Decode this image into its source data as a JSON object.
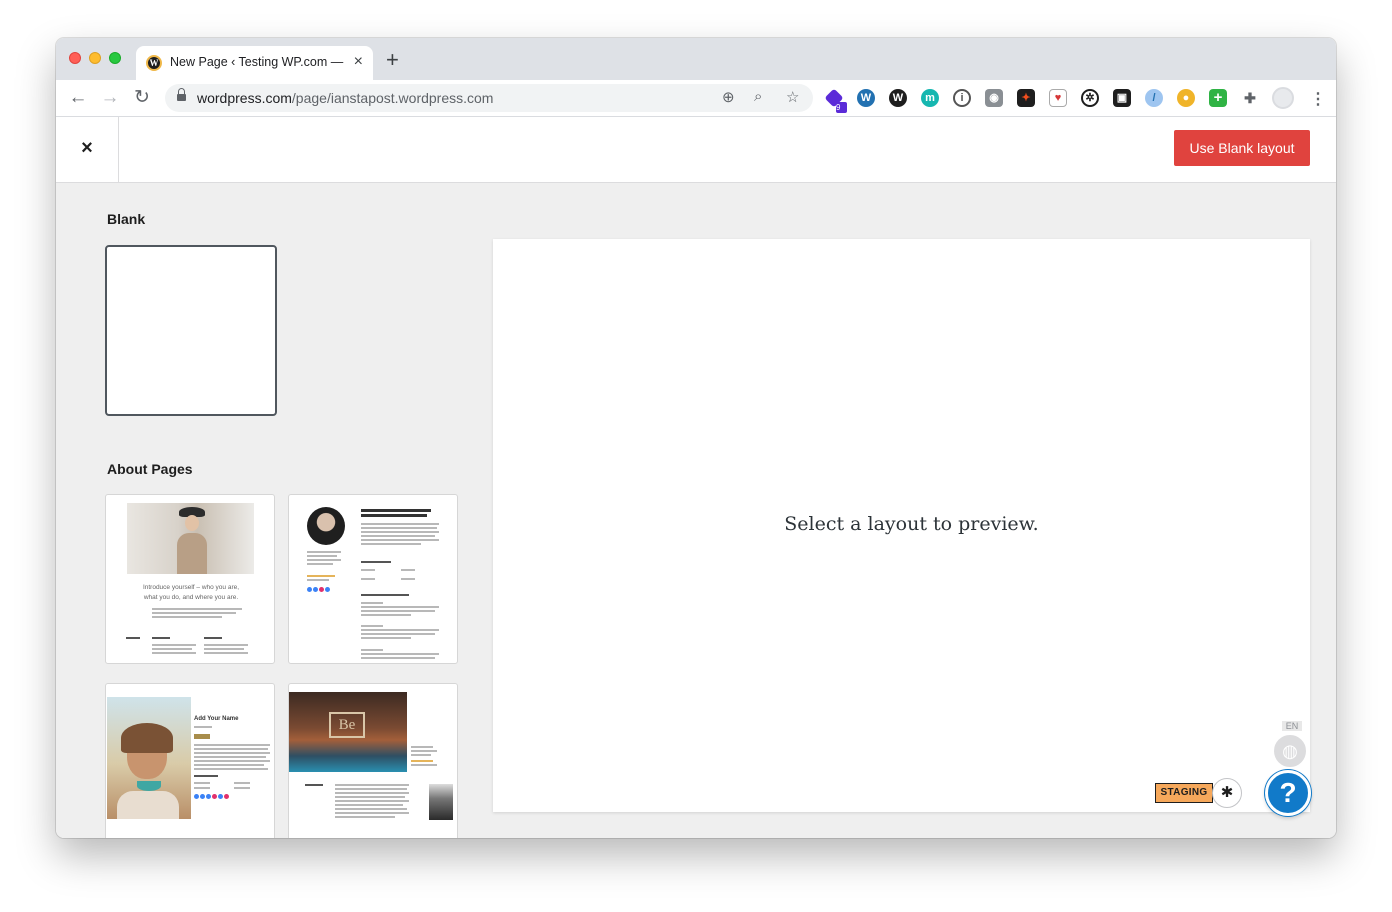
{
  "browser": {
    "tab_title": "New Page ‹ Testing WP.com —",
    "tab_close_glyph": "×",
    "new_tab_glyph": "+",
    "url_host": "wordpress.com",
    "url_path": "/page/ianstapost.wordpress.com",
    "extension_badge": "9",
    "extensions": [
      "wordpress-icon",
      "wordpress-icon",
      "m-icon",
      "info-icon",
      "camera-icon",
      "figma-icon",
      "card-icon",
      "soccer-icon",
      "box-icon",
      "feather-icon",
      "bullet-icon",
      "plus-icon",
      "puzzle-icon",
      "profile-icon"
    ]
  },
  "header": {
    "close_glyph": "×",
    "use_blank_label": "Use Blank layout",
    "accent_color": "#e0433e"
  },
  "sidebar": {
    "blank_heading": "Blank",
    "about_heading": "About Pages",
    "thumb1_text_line1": "Introduce yourself – who you are,",
    "thumb1_text_line2": "what you do, and where you are.",
    "thumb3_title": "Add Your Name"
  },
  "preview": {
    "message": "Select a layout to preview."
  },
  "widgets": {
    "staging_label": "STAGING",
    "language_label": "EN",
    "help_glyph": "?",
    "help_color": "#117ac9"
  }
}
